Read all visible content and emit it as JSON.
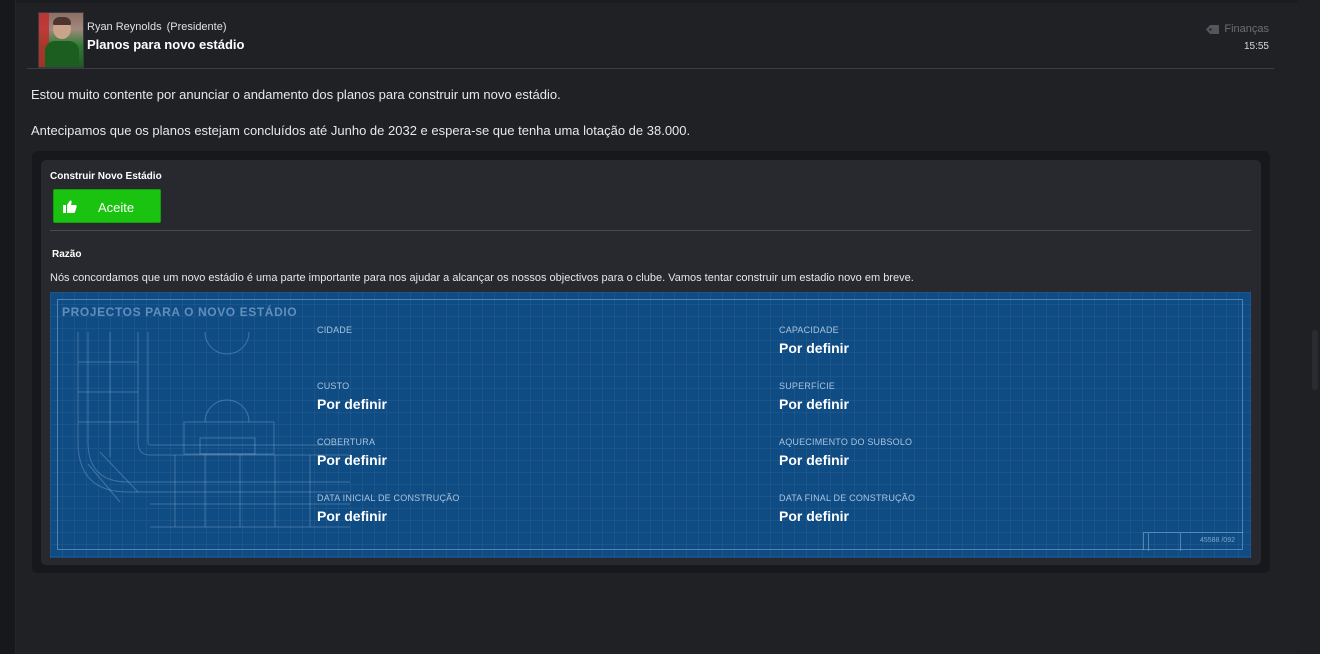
{
  "message": {
    "sender_name": "Ryan Reynolds",
    "sender_role": "(Presidente)",
    "subject": "Planos para novo estádio",
    "category": "Finanças",
    "time": "15:55",
    "paragraphs": [
      "Estou muito contente por anunciar o andamento dos planos para construir um novo estádio.",
      "Antecipamos que os planos estejam concluídos até Junho de 2032 e espera-se que tenha uma lotação de 38.000."
    ]
  },
  "decision": {
    "title": "Construir Novo Estádio",
    "button_label": "Aceite",
    "reason_title": "Razão",
    "reason_text": "Nós concordamos que um novo estádio é uma parte importante para nos ajudar a alcançar os nossos objectivos para o clube. Vamos tentar construir um estadio novo em breve."
  },
  "blueprint": {
    "title": "PROJECTOS PARA O NOVO ESTÁDIO",
    "stamp_code": "45588 /092",
    "fields": [
      {
        "label": "CIDADE",
        "value": ""
      },
      {
        "label": "CAPACIDADE",
        "value": "Por definir"
      },
      {
        "label": "CUSTO",
        "value": "Por definir"
      },
      {
        "label": "SUPERFÍCIE",
        "value": "Por definir"
      },
      {
        "label": "COBERTURA",
        "value": "Por definir"
      },
      {
        "label": "AQUECIMENTO DO SUBSOLO",
        "value": "Por definir"
      },
      {
        "label": "DATA INICIAL DE CONSTRUÇÃO",
        "value": "Por definir"
      },
      {
        "label": "DATA FINAL DE CONSTRUÇÃO",
        "value": "Por definir"
      }
    ]
  },
  "icons": {
    "category": "tag-icon",
    "button": "thumbs-up-icon"
  },
  "colors": {
    "accept": "#19c30f",
    "blueprint": "#104c84",
    "background": "#202125"
  }
}
